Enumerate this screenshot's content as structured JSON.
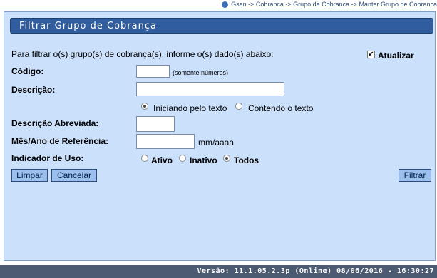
{
  "breadcrumb": "Gsan -> Cobranca -> Grupo de Cobranca -> Manter Grupo de Cobranca",
  "panel": {
    "title": "Filtrar Grupo de Cobrança"
  },
  "form": {
    "instructions": "Para filtrar o(s) grupo(s) de cobrança(s), informe o(s) dado(s) abaixo:",
    "atualizar_label": "Atualizar",
    "atualizar_checked": true,
    "codigo_label": "Código:",
    "codigo_value": "",
    "codigo_hint": "(somente números)",
    "descricao_label": "Descrição:",
    "descricao_value": "",
    "match_options": [
      "Iniciando pelo texto",
      "Contendo o texto"
    ],
    "match_selected": "Iniciando pelo texto",
    "desc_abrev_label": "Descrição Abreviada:",
    "desc_abrev_value": "",
    "mes_ano_label": "Mês/Ano de Referência:",
    "mes_ano_value": "",
    "mes_ano_hint": "mm/aaaa",
    "indicador_label": "Indicador de Uso:",
    "indicador_options": [
      "Ativo",
      "Inativo",
      "Todos"
    ],
    "indicador_selected": "Todos"
  },
  "buttons": {
    "limpar": "Limpar",
    "cancelar": "Cancelar",
    "filtrar": "Filtrar"
  },
  "footer": {
    "version": "Versão: 11.1.05.2.3p (Online) 08/06/2016 - 16:30:27"
  },
  "colors": {
    "panel_bg": "#cbe0fb",
    "title_bg": "#2f5d9e",
    "footer_bg": "#4c5a72",
    "button_bg": "#9cc0ee"
  }
}
